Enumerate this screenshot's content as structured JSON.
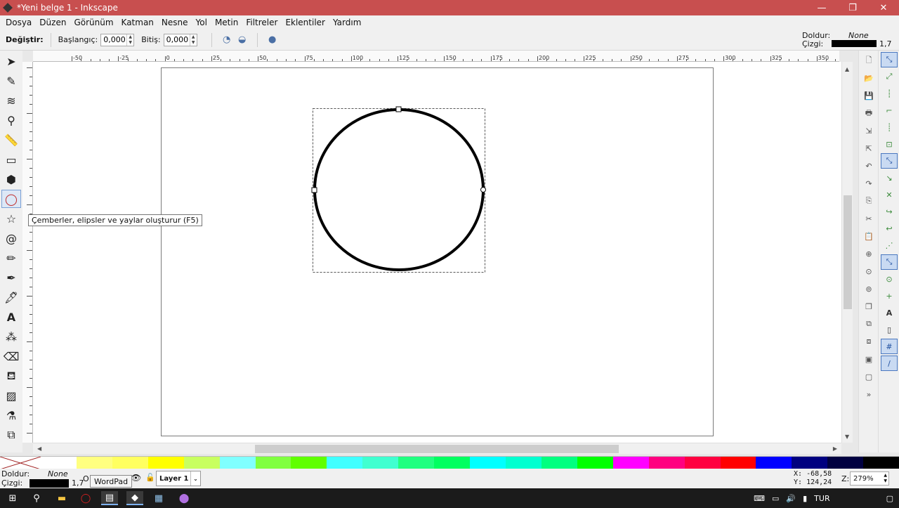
{
  "window": {
    "title": "*Yeni belge 1 - Inkscape",
    "minimize": "—",
    "maximize": "❐",
    "close": "✕"
  },
  "menu": [
    "Dosya",
    "Düzen",
    "Görünüm",
    "Katman",
    "Nesne",
    "Yol",
    "Metin",
    "Filtreler",
    "Eklentiler",
    "Yardım"
  ],
  "controls": {
    "change_label": "Değiştir:",
    "start_label": "Başlangıç:",
    "start_value": "0,000",
    "end_label": "Bitiş:",
    "end_value": "0,000"
  },
  "style_indicator": {
    "fill_label": "Doldur:",
    "fill_value": "None",
    "stroke_label": "Çizgi:",
    "stroke_width": "1,7"
  },
  "ruler_ticks": [
    "-50",
    "-25",
    "0",
    "25",
    "50",
    "75",
    "100",
    "125",
    "150",
    "175",
    "200",
    "225",
    "250",
    "275",
    "300",
    "325",
    "350"
  ],
  "tooltip": "Çemberler, elipsler ve yaylar oluşturur (F5)",
  "status": {
    "fill_label": "Doldur:",
    "fill_value": "None",
    "stroke_label": "Çizgi:",
    "stroke_width": "1,7",
    "opacity_label": "O",
    "layer": "Layer 1",
    "x_label": "X:",
    "x_value": "-68,58",
    "y_label": "Y:",
    "y_value": "124,24",
    "zoom_label": "Z:",
    "zoom_value": "279%"
  },
  "wordpad_tooltip": "WordPad",
  "tray": {
    "language": "TUR"
  },
  "palette_colors": [
    "#ffffff",
    "#ffff80",
    "#ffff60",
    "#ffff00",
    "#c8ff60",
    "#80ffff",
    "#80ff40",
    "#60ff00",
    "#40ffff",
    "#40ffd0",
    "#20ff80",
    "#00ff60",
    "#00ffff",
    "#00ffd0",
    "#00ff80",
    "#00ff00",
    "#ff00ff",
    "#ff0080",
    "#ff0040",
    "#ff0000",
    "#0000ff",
    "#000080",
    "#000040",
    "#000000"
  ]
}
